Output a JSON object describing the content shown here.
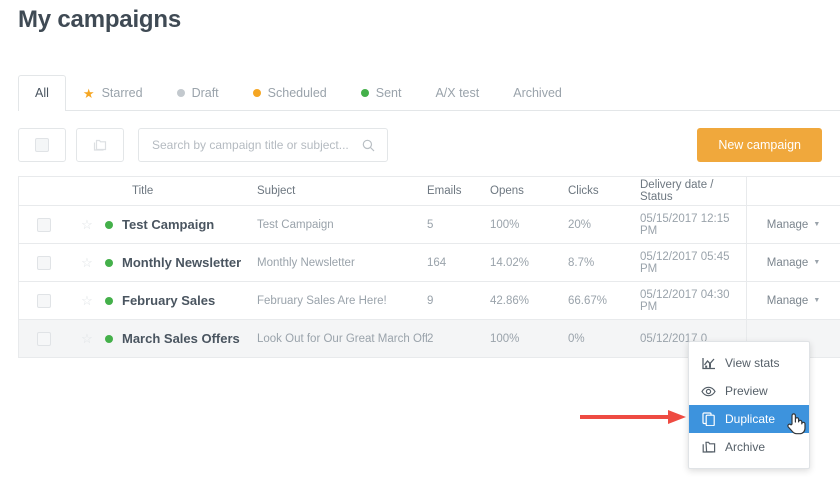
{
  "page": {
    "title": "My campaigns"
  },
  "tabs": [
    {
      "label": "All",
      "icon": "none",
      "active": true
    },
    {
      "label": "Starred",
      "icon": "star-icon",
      "active": false
    },
    {
      "label": "Draft",
      "icon": "gray-dot",
      "active": false
    },
    {
      "label": "Scheduled",
      "icon": "orange-dot",
      "active": false
    },
    {
      "label": "Sent",
      "icon": "green-dot",
      "active": false
    },
    {
      "label": "A/X test",
      "icon": "none",
      "active": false
    },
    {
      "label": "Archived",
      "icon": "none",
      "active": false
    }
  ],
  "toolbar": {
    "select_all_icon": "checkbox-icon",
    "folder_icon": "folder-icon",
    "search": {
      "value": "",
      "placeholder": "Search by campaign title or subject..."
    },
    "search_icon": "search-icon",
    "new_campaign_label": "New campaign"
  },
  "table": {
    "columns": [
      "",
      "",
      "Title",
      "Subject",
      "Emails",
      "Opens",
      "Clicks",
      "Delivery date / Status",
      ""
    ],
    "headers": {
      "title": "Title",
      "subject": "Subject",
      "emails": "Emails",
      "opens": "Opens",
      "clicks": "Clicks",
      "delivery": "Delivery date / Status"
    },
    "manage_label": "Manage",
    "rows": [
      {
        "title": "Test Campaign",
        "subject": "Test Campaign",
        "emails": "5",
        "opens": "100%",
        "clicks": "20%",
        "delivery": "05/15/2017 12:15 PM",
        "status": "green",
        "starred": false,
        "checked": false,
        "hovered": false,
        "manage": "Manage"
      },
      {
        "title": "Monthly Newsletter",
        "subject": "Monthly Newsletter",
        "emails": "164",
        "opens": "14.02%",
        "clicks": "8.7%",
        "delivery": "05/12/2017 05:45 PM",
        "status": "green",
        "starred": false,
        "checked": false,
        "hovered": false,
        "manage": "Manage"
      },
      {
        "title": "February Sales",
        "subject": "February Sales Are Here!",
        "emails": "9",
        "opens": "42.86%",
        "clicks": "66.67%",
        "delivery": "05/12/2017 04:30 PM",
        "status": "green",
        "starred": false,
        "checked": false,
        "hovered": false,
        "manage": "Manage"
      },
      {
        "title": "March Sales Offers",
        "subject": "Look Out for Our Great March Off...",
        "emails": "2",
        "opens": "100%",
        "clicks": "0%",
        "delivery": "05/12/2017 0",
        "status": "green",
        "starred": false,
        "checked": false,
        "hovered": true,
        "manage": ""
      }
    ]
  },
  "dropdown": {
    "items": [
      {
        "label": "View stats",
        "icon": "chart-icon",
        "selected": false
      },
      {
        "label": "Preview",
        "icon": "eye-icon",
        "selected": false
      },
      {
        "label": "Duplicate",
        "icon": "copy-icon",
        "selected": true
      },
      {
        "label": "Archive",
        "icon": "archive-icon",
        "selected": false
      }
    ]
  },
  "annotation": {
    "arrow_color": "#ee4b42",
    "points_to": "Duplicate"
  },
  "colors": {
    "accent_orange": "#f0a83c",
    "status_green": "#44b04a",
    "star_yellow": "#f5a623",
    "highlight_blue": "#3d93dd",
    "text_dark": "#3f4a54",
    "text_muted": "#9aa3ab",
    "border": "#e8eaec",
    "row_hover": "#f4f5f6"
  }
}
